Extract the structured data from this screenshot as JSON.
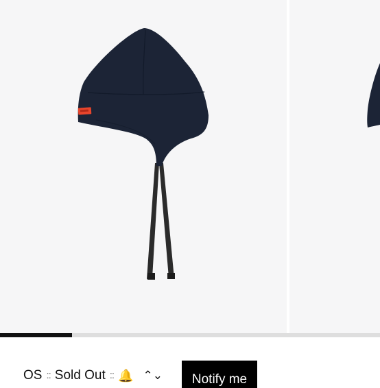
{
  "gallery": {
    "progress": 0.19
  },
  "purchase": {
    "size": "OS",
    "separator": "::",
    "availability": "Sold Out",
    "separator_2": "::",
    "bell_icon_glyph": "🔔",
    "chevron_glyph": "⌃⌄",
    "notify_label": "Notify me"
  },
  "colors": {
    "product": "#1c2436",
    "label": "#e8452c",
    "strap": "#2b2b2b",
    "background": "#f6f6f7"
  }
}
